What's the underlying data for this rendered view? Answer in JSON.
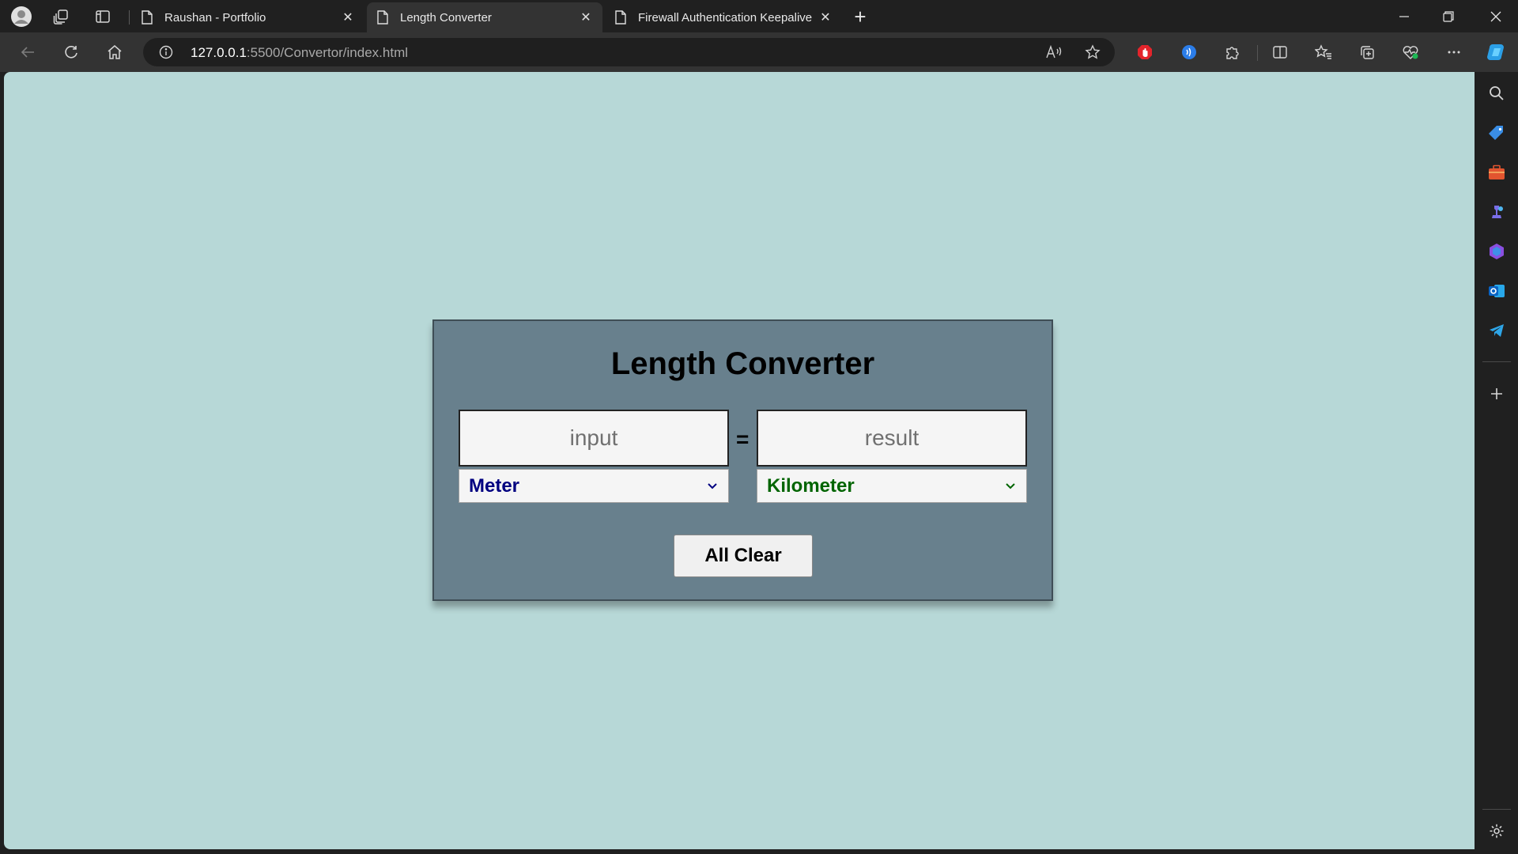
{
  "browser": {
    "tabs": [
      {
        "title": "Raushan - Portfolio",
        "active": false
      },
      {
        "title": "Length Converter",
        "active": true
      },
      {
        "title": "Firewall Authentication Keepalive",
        "active": false
      }
    ],
    "url_host": "127.0.0.1",
    "url_rest": ":5500/Convertor/index.html"
  },
  "app": {
    "title": "Length Converter",
    "input_placeholder": "input",
    "result_placeholder": "result",
    "equals": "=",
    "from_unit": "Meter",
    "to_unit": "Kilometer",
    "clear_label": "All Clear"
  },
  "colors": {
    "page_background": "#b7d8d7",
    "card_background": "#68808d",
    "from_unit_text": "#000080",
    "to_unit_text": "#006400"
  },
  "icons": {
    "tabstrip": [
      "profile-avatar-icon",
      "workspaces-icon",
      "tab-actions-icon"
    ],
    "toolbar": [
      "back-arrow-icon",
      "refresh-icon",
      "home-icon",
      "site-info-icon",
      "read-aloud-icon",
      "favorite-star-icon",
      "adblock-extension-icon",
      "audio-extension-icon",
      "extensions-puzzle-icon",
      "split-screen-icon",
      "favorites-icon",
      "collections-icon",
      "browser-essentials-icon",
      "more-options-icon",
      "copilot-icon"
    ],
    "sidebar": [
      "search-icon",
      "shopping-tag-icon",
      "tools-briefcase-icon",
      "games-icon",
      "microsoft-365-icon",
      "outlook-icon",
      "telegram-icon",
      "add-icon",
      "settings-gear-icon"
    ]
  }
}
